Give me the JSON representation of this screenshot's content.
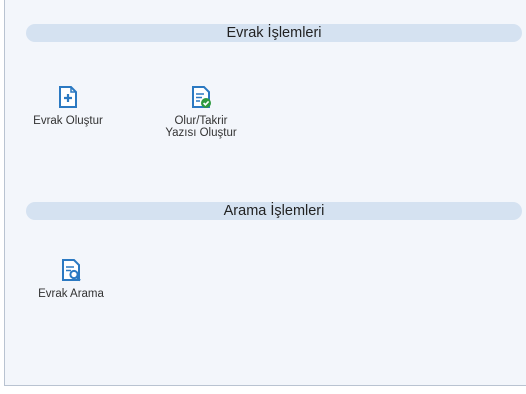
{
  "sections": [
    {
      "title": "Evrak İşlemleri",
      "items": [
        {
          "label": "Evrak Oluştur",
          "icon": "document-add-icon"
        },
        {
          "label": "Olur/Takrir",
          "label2": "Yazısı Oluştur",
          "icon": "document-approve-icon"
        }
      ]
    },
    {
      "title": "Arama İşlemleri",
      "items": [
        {
          "label": "Evrak Arama",
          "icon": "document-search-icon"
        }
      ]
    }
  ],
  "colors": {
    "accent": "#2b79c2",
    "section_bg": "#d5e2f1",
    "panel_bg": "#f3f6fb",
    "approve_green": "#2e9a3e"
  }
}
